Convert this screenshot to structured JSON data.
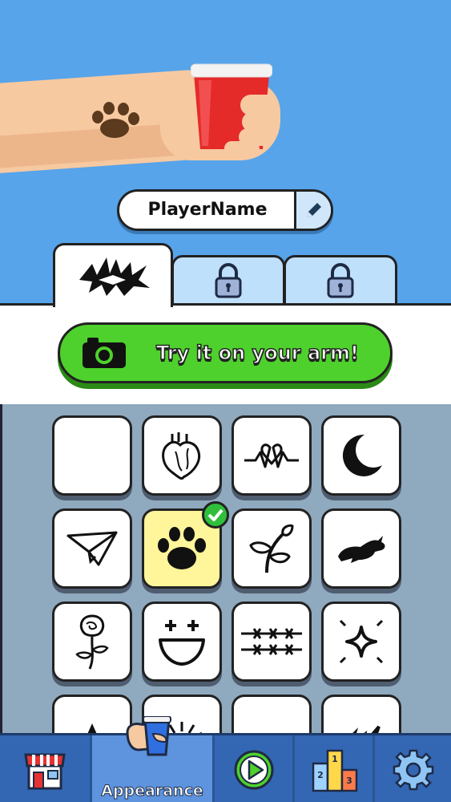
{
  "player": {
    "name": "PlayerName"
  },
  "tabs": [
    {
      "icon": "tribal-tattoo-icon",
      "active": true
    },
    {
      "icon": "lock-icon",
      "locked": true
    },
    {
      "icon": "lock-icon",
      "locked": true
    }
  ],
  "try_button": {
    "label": "Try it on your arm!",
    "icon": "camera-icon"
  },
  "tattoos": [
    {
      "icon": "blank-icon"
    },
    {
      "icon": "anatomical-heart-icon"
    },
    {
      "icon": "heartbeat-icon"
    },
    {
      "icon": "crescent-moon-icon"
    },
    {
      "icon": "paper-plane-icon"
    },
    {
      "icon": "paw-print-icon",
      "selected": true
    },
    {
      "icon": "sprout-icon"
    },
    {
      "icon": "rabbit-icon"
    },
    {
      "icon": "rose-icon"
    },
    {
      "icon": "smiley-face-icon"
    },
    {
      "icon": "barbed-wire-icon"
    },
    {
      "icon": "sparkle-icon"
    },
    {
      "icon": "star-icon"
    },
    {
      "icon": "sunburst-icon"
    },
    {
      "icon": "tribal-icon"
    },
    {
      "icon": "abstract-icon"
    }
  ],
  "nav": {
    "items": [
      {
        "icon": "shop-icon"
      },
      {
        "icon": "cup-hand-icon",
        "label": "Appearance",
        "active": true
      },
      {
        "icon": "play-icon"
      },
      {
        "icon": "podium-icon",
        "ranks": [
          "2",
          "1",
          "3"
        ]
      },
      {
        "icon": "gear-icon"
      }
    ]
  },
  "colors": {
    "sky": "#57a4ea",
    "button": "#4ed12c",
    "nav": "#3367b4",
    "selected": "#fff59a"
  }
}
